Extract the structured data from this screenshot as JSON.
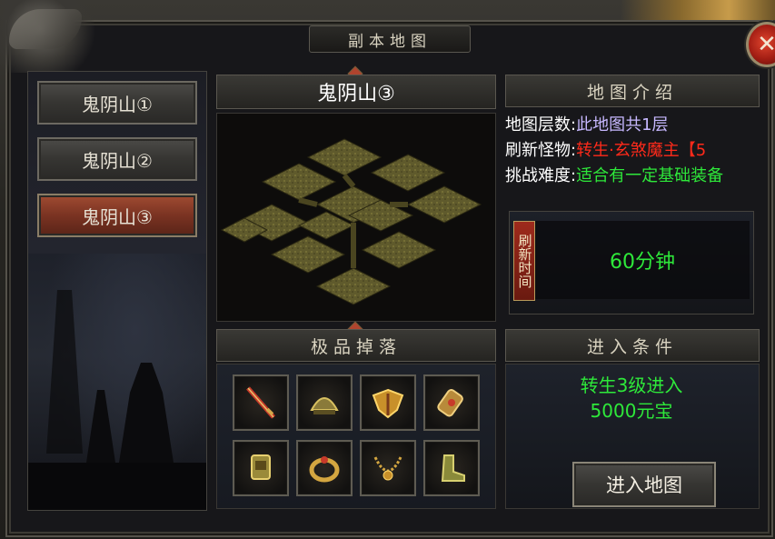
{
  "window": {
    "title": "副本地图",
    "close_label": "✕"
  },
  "map_list": [
    {
      "label": "鬼阴山①",
      "active": false
    },
    {
      "label": "鬼阴山②",
      "active": false
    },
    {
      "label": "鬼阴山③",
      "active": true
    }
  ],
  "map_view": {
    "title": "鬼阴山③"
  },
  "drops": {
    "title": "极品掉落",
    "items": [
      {
        "icon": "sword-icon"
      },
      {
        "icon": "helmet-icon"
      },
      {
        "icon": "wings-armor-icon"
      },
      {
        "icon": "bracer-icon"
      },
      {
        "icon": "belt-icon"
      },
      {
        "icon": "ring-icon"
      },
      {
        "icon": "necklace-icon"
      },
      {
        "icon": "boots-icon"
      }
    ]
  },
  "map_intro": {
    "title": "地图介绍",
    "lines": [
      {
        "label": "地图层数:",
        "value": "此地图共1层"
      },
      {
        "label": "刷新怪物:",
        "value": "转生·玄煞魔主【5"
      },
      {
        "label": "挑战难度:",
        "value": "适合有一定基础装备"
      }
    ]
  },
  "refresh": {
    "tag": "刷新时间",
    "time": "60分钟"
  },
  "conditions": {
    "title": "进入条件",
    "lines": [
      "转生3级进入",
      "5000元宝"
    ]
  },
  "enter_button": "进入地图",
  "colors": {
    "green": "#2ee83a",
    "red": "#ff2a1a",
    "lavender": "#c7b8ff",
    "active_tab": "#7a3322"
  }
}
